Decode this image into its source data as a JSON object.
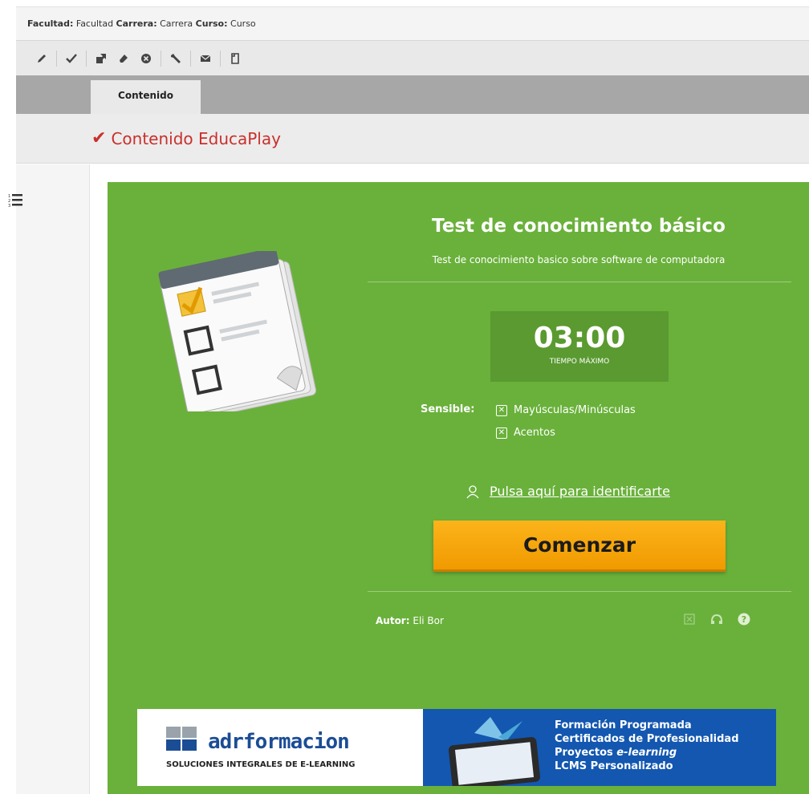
{
  "breadcrumb": {
    "facultad_label": "Facultad:",
    "facultad_value": "Facultad",
    "carrera_label": "Carrera:",
    "carrera_value": "Carrera",
    "curso_label": "Curso:",
    "curso_value": "Curso"
  },
  "toolbar": {
    "icons": [
      "pencil-icon",
      "check-icon",
      "export-icon",
      "eraser-icon",
      "delete-circle-icon",
      "wrench-icon",
      "envelope-icon",
      "document-icon"
    ]
  },
  "tabs": [
    {
      "label": "Contenido"
    }
  ],
  "section": {
    "title": "Contenido EducaPlay"
  },
  "game": {
    "title": "Test de conocimiento básico",
    "subtitle": "Test de conocimiento basico sobre software de computadora",
    "timer_value": "03:00",
    "timer_label": "TIEMPO MÁXIMO",
    "sensible_label": "Sensible:",
    "options": [
      {
        "label": "Mayúsculas/Minúsculas",
        "checked": true
      },
      {
        "label": "Acentos",
        "checked": true
      }
    ],
    "identify_link": "Pulsa aquí para identificarte",
    "start_button": "Comenzar",
    "author_label": "Autor:",
    "author_name": "Eli Bor",
    "background_color": "#6ab13b",
    "button_color": "#f7a80d"
  },
  "banner": {
    "logo_text": "adrformacion",
    "tagline": "SOLUCIONES INTEGRALES DE E-LEARNING",
    "line1": "Formación Programada",
    "line2": "Certificados de Profesionalidad",
    "line3_prefix": "Proyectos ",
    "line3_em": "e-learning",
    "line4": "LCMS Personalizado"
  }
}
